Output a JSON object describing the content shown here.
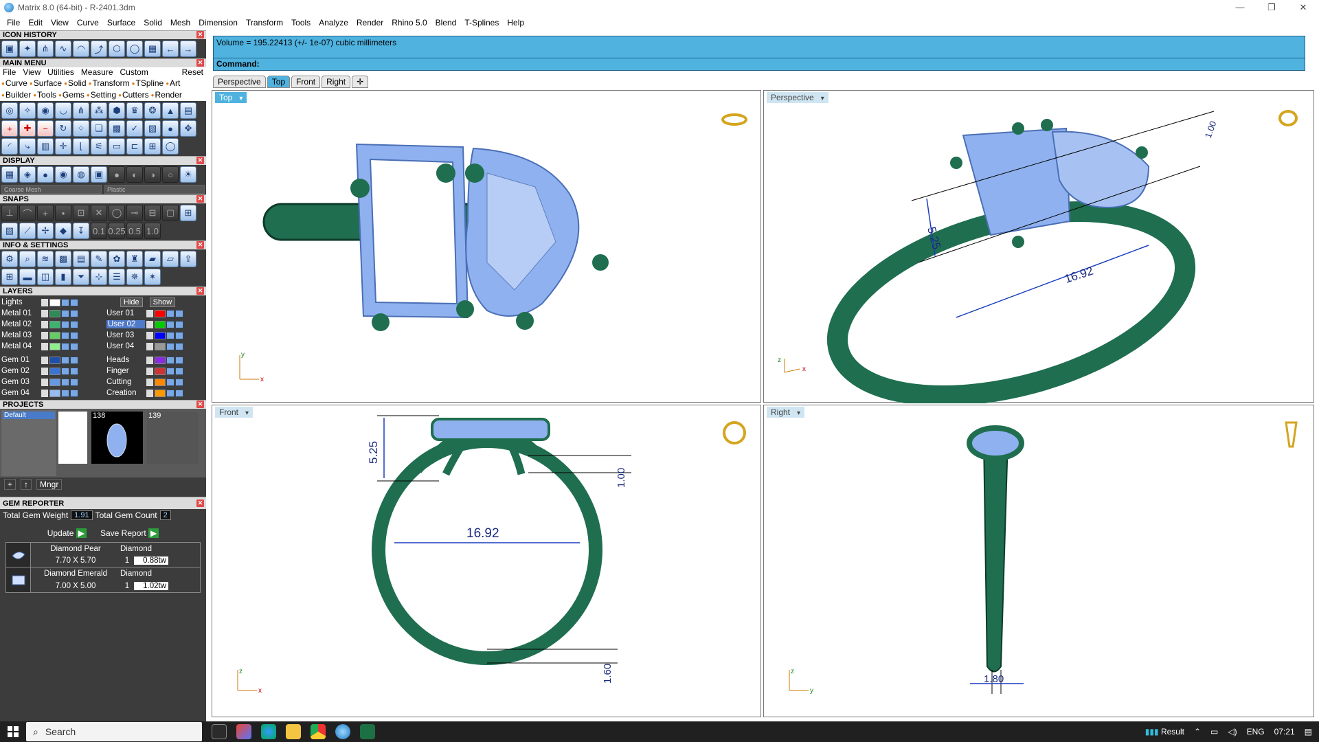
{
  "window": {
    "title": "Matrix 8.0 (64-bit) - R-2401.3dm",
    "min": "—",
    "max": "❐",
    "close": "✕"
  },
  "menubar": [
    "File",
    "Edit",
    "View",
    "Curve",
    "Surface",
    "Solid",
    "Mesh",
    "Dimension",
    "Transform",
    "Tools",
    "Analyze",
    "Render",
    "Rhino 5.0",
    "Blend",
    "T-Splines",
    "Help"
  ],
  "panels": {
    "icon_history": "ICON HISTORY",
    "main_menu": "MAIN MENU",
    "display": "DISPLAY",
    "snaps": "SNAPS",
    "info_settings": "INFO & SETTINGS",
    "layers": "LAYERS",
    "projects": "PROJECTS",
    "gem_reporter": "GEM REPORTER"
  },
  "main_menu": {
    "row1": [
      "File",
      "View",
      "Utilities",
      "Measure",
      "Custom"
    ],
    "reset": "Reset",
    "row2": [
      "Curve",
      "Surface",
      "Solid",
      "Transform",
      "TSpline",
      "Art"
    ],
    "row3": [
      "Builder",
      "Tools",
      "Gems",
      "Setting",
      "Cutters",
      "Render"
    ]
  },
  "display": {
    "mesh": "Coarse Mesh",
    "material": "Plastic"
  },
  "snap_values": [
    "0.1",
    "0.25",
    "0.5",
    "1.0"
  ],
  "layers": {
    "hide_label": "Hide",
    "show_label": "Show",
    "left": [
      "Lights",
      "Metal 01",
      "Metal 02",
      "Metal 03",
      "Metal 04",
      "Gem 01",
      "Gem 02",
      "Gem 03",
      "Gem 04"
    ],
    "left_colors": [
      "#ffffff",
      "#2e8b57",
      "#3cb371",
      "#66cc66",
      "#90ee90",
      "#1f4fa8",
      "#3b73d1",
      "#6699e0",
      "#99bbf0"
    ],
    "right": [
      "User 01",
      "User 02",
      "User 03",
      "User 04",
      "Heads",
      "Finger",
      "Cutting",
      "Creation"
    ],
    "right_colors": [
      "#ff0000",
      "#00cc00",
      "#0000ff",
      "#999999",
      "#8a2be2",
      "#cc3333",
      "#ff8800",
      "#ff9900"
    ]
  },
  "projects": {
    "default": "Default",
    "thumbs": [
      "138",
      "139"
    ],
    "mngr": "Mngr"
  },
  "gem_reporter": {
    "total_weight_label": "Total Gem Weight",
    "total_weight": "1.91",
    "total_count_label": "Total Gem Count",
    "total_count": "2",
    "update": "Update",
    "save_report": "Save Report",
    "gems": [
      {
        "name": "Diamond Pear",
        "type": "Diamond",
        "size": "7.70 X 5.70",
        "qty": "1",
        "tw": "0.88tw"
      },
      {
        "name": "Diamond Emerald",
        "type": "Diamond",
        "size": "7.00 X 5.00",
        "qty": "1",
        "tw": "1.02tw"
      }
    ]
  },
  "command": {
    "output": "Volume = 195.22413 (+/- 1e-07) cubic millimeters",
    "prompt": "Command:"
  },
  "viewport_tabs": [
    "Perspective",
    "Top",
    "Front",
    "Right"
  ],
  "active_tab": "Top",
  "viewports": {
    "top": "Top",
    "perspective": "Perspective",
    "front": "Front",
    "right": "Right"
  },
  "dimensions": {
    "height": "5.25",
    "prong": "1.00",
    "diameter": "16.92",
    "shank": "1.60",
    "width": "1.80"
  },
  "axes": {
    "x": "x",
    "y": "y",
    "z": "z"
  },
  "taskbar": {
    "search": "Search",
    "weather": "Result",
    "lang": "ENG",
    "time": "07:21"
  },
  "colors": {
    "metal": "#1f6e4f",
    "gem": "#8fb1ef",
    "accent": "#4fb2df"
  }
}
